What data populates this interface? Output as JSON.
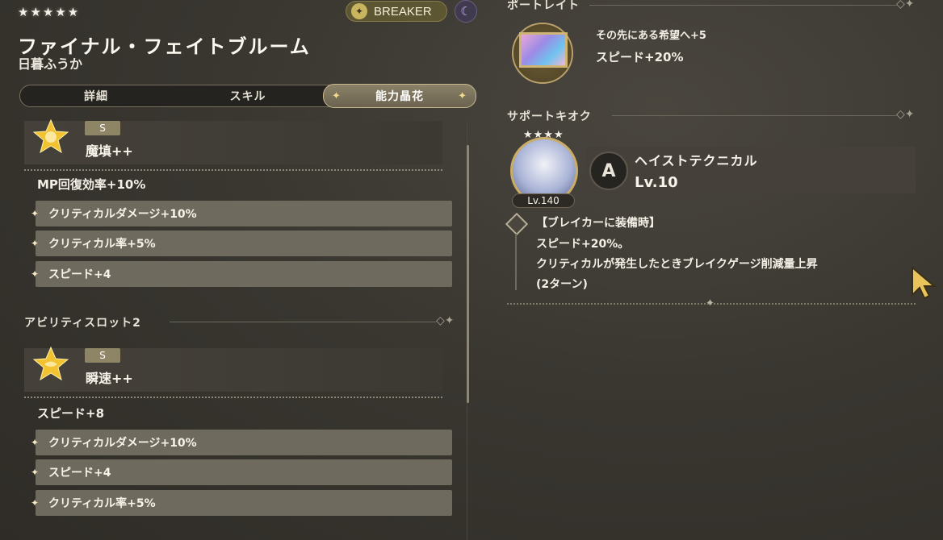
{
  "header": {
    "stars": "★★★★★",
    "name": "ファイナル・フェイトブルーム",
    "character": "日暮ふうか",
    "role": "BREAKER",
    "element_icon": "crescent-moon-icon"
  },
  "tabs": [
    {
      "label": "詳細",
      "active": false
    },
    {
      "label": "スキル",
      "active": false
    },
    {
      "label": "能力晶花",
      "active": true
    }
  ],
  "slots": [
    {
      "grade": "S",
      "name": "魔填++",
      "main_stat": "MP回復効率+10%",
      "sub_stats": [
        "クリティカルダメージ+10%",
        "クリティカル率+5%",
        "スピード+4"
      ]
    },
    {
      "section": "アビリティスロット2",
      "grade": "S",
      "name": "瞬速++",
      "main_stat": "スピード+8",
      "sub_stats": [
        "クリティカルダメージ+10%",
        "スピード+4",
        "クリティカル率+5%"
      ]
    }
  ],
  "portrait": {
    "section": "ポートレイト",
    "title": "その先にある希望へ+5",
    "stat": "スピード+20%"
  },
  "support_memory": {
    "section": "サポートキオク",
    "level": "Lv.140",
    "skill_name": "ヘイストテクニカル",
    "skill_level": "Lv.10",
    "desc_lines": [
      "【ブレイカーに装備時】",
      "スピード+20%。",
      "クリティカルが発生したときブレイクゲージ削減量上昇",
      "(2ターン)"
    ]
  },
  "colors": {
    "accent_gold": "#c9ad66",
    "panel": "#45413a",
    "substat": "#6e6a5d"
  }
}
